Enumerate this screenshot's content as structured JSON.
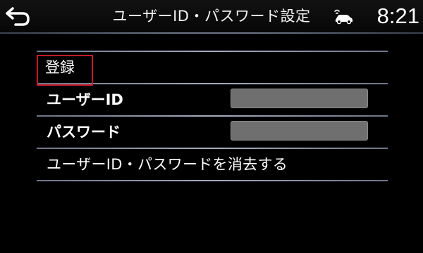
{
  "header": {
    "back_icon": "back-arrow-icon",
    "title": "ユーザーID・パスワード設定",
    "status_icon": "vehicle-signal-icon",
    "clock": "8:21"
  },
  "list": {
    "register": {
      "label": "登録",
      "focused": true
    },
    "user_id": {
      "label": "ユーザーID",
      "value": ""
    },
    "password": {
      "label": "パスワード",
      "value": ""
    },
    "delete": {
      "label": "ユーザーID・パスワードを消去する"
    }
  },
  "colors": {
    "background": "#000000",
    "focus": "#c41a2b",
    "separator": "#a4acbf",
    "field": "#6f6f6f"
  }
}
